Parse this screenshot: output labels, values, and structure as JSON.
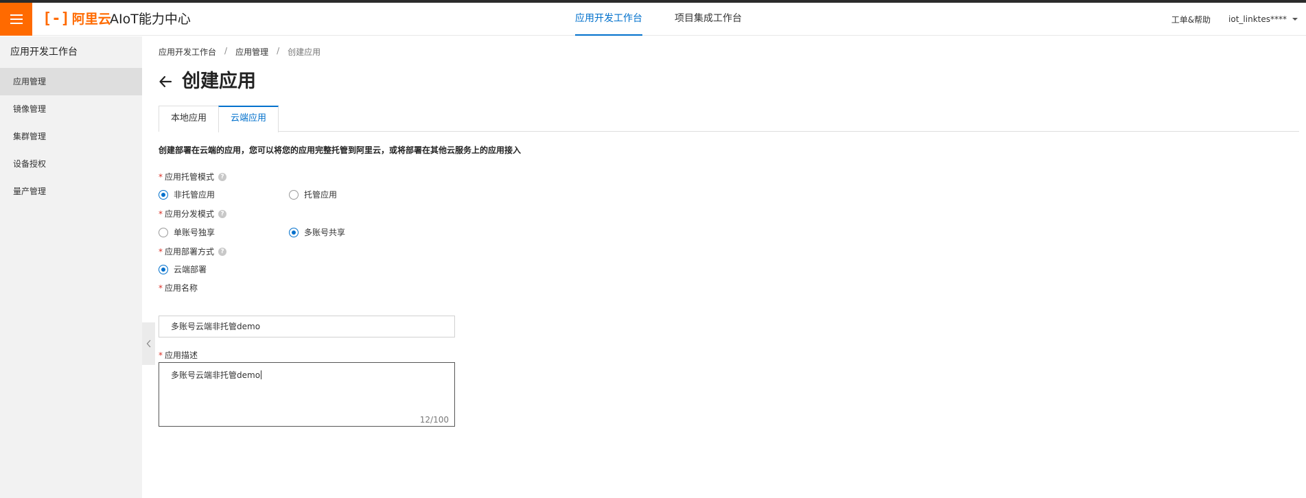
{
  "header": {
    "logo_text": "阿里云",
    "app_title": "AIoT能力中心",
    "nav": [
      {
        "label": "应用开发工作台",
        "active": true
      },
      {
        "label": "项目集成工作台",
        "active": false
      }
    ],
    "help_label": "工单&帮助",
    "username": "iot_linktes****"
  },
  "sidebar": {
    "title": "应用开发工作台",
    "items": [
      {
        "label": "应用管理",
        "active": true
      },
      {
        "label": "镜像管理"
      },
      {
        "label": "集群管理"
      },
      {
        "label": "设备授权"
      },
      {
        "label": "量产管理"
      }
    ]
  },
  "breadcrumb": [
    "应用开发工作台",
    "应用管理",
    "创建应用"
  ],
  "page_title": "创建应用",
  "tabs": [
    {
      "label": "本地应用",
      "active": false
    },
    {
      "label": "云端应用",
      "active": true
    }
  ],
  "description": "创建部署在云端的应用，您可以将您的应用完整托管到阿里云，或将部署在其他云服务上的应用接入",
  "form": {
    "hosting_mode": {
      "label": "应用托管模式",
      "options": [
        "非托管应用",
        "托管应用"
      ],
      "selected": "非托管应用"
    },
    "distribution_mode": {
      "label": "应用分发模式",
      "options": [
        "单账号独享",
        "多账号共享"
      ],
      "selected": "多账号共享"
    },
    "deploy_method": {
      "label": "应用部署方式",
      "options": [
        "云端部署"
      ],
      "selected": "云端部署"
    },
    "app_name": {
      "label": "应用名称",
      "value": "多账号云端非托管demo"
    },
    "app_desc": {
      "label": "应用描述",
      "value": "多账号云端非托管demo",
      "counter": "12/100"
    }
  },
  "colors": {
    "brand": "#ff6a00",
    "accent": "#0070cc",
    "required": "#d93026"
  },
  "icons": {
    "menu": "hamburger-icon",
    "back": "arrow-left-icon",
    "help": "question-circle-icon",
    "collapse": "chevron-left-icon",
    "dropdown": "caret-down-icon"
  }
}
